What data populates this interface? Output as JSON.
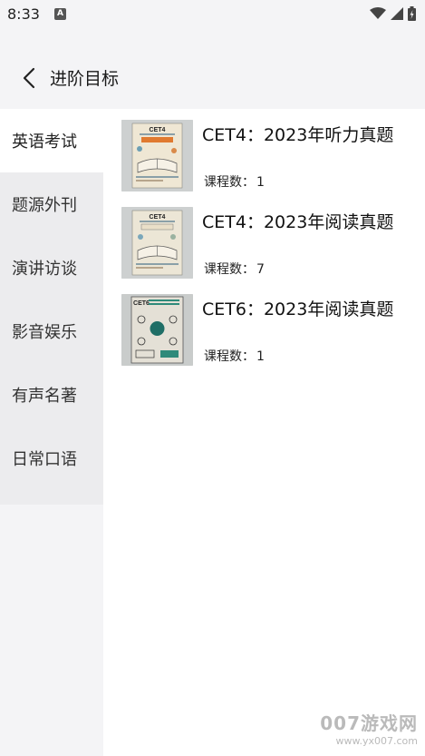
{
  "status": {
    "time": "8:33",
    "notif_glyph": "A"
  },
  "header": {
    "title": "进阶目标"
  },
  "sidebar": {
    "items": [
      {
        "label": "英语考试"
      },
      {
        "label": "题源外刊"
      },
      {
        "label": "演讲访谈"
      },
      {
        "label": "影音娱乐"
      },
      {
        "label": "有声名著"
      },
      {
        "label": "日常口语"
      }
    ]
  },
  "courses": [
    {
      "title": "CET4：2023年听力真题",
      "count_label": "课程数：",
      "count": "1",
      "cover_tag": "CET4"
    },
    {
      "title": "CET4：2023年阅读真题",
      "count_label": "课程数：",
      "count": "7",
      "cover_tag": "CET4"
    },
    {
      "title": "CET6：2023年阅读真题",
      "count_label": "课程数：",
      "count": "1",
      "cover_tag": "CET6"
    }
  ],
  "watermark": {
    "main": "007游戏网",
    "url": "www.yx007.com"
  },
  "colors": {
    "background": "#f4f4f6",
    "sidebar": "#ececee",
    "content": "#ffffff"
  }
}
